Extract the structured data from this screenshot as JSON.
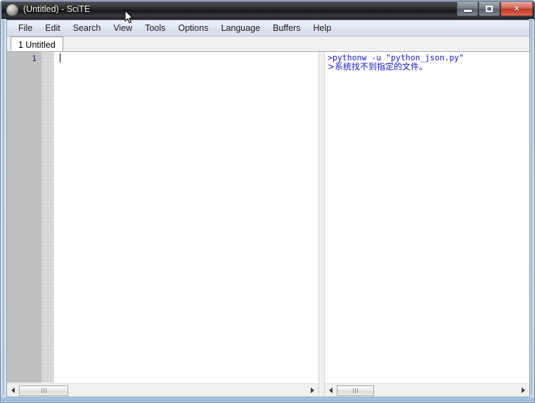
{
  "window": {
    "title": "(Untitled) - SciTE",
    "icon": "scite-ball-icon",
    "buttons": {
      "minimize": "minimize-button",
      "restore": "restore-button",
      "close_label": "✕"
    }
  },
  "menubar": {
    "items": [
      {
        "label": "File"
      },
      {
        "label": "Edit"
      },
      {
        "label": "Search"
      },
      {
        "label": "View"
      },
      {
        "label": "Tools"
      },
      {
        "label": "Options"
      },
      {
        "label": "Language"
      },
      {
        "label": "Buffers"
      },
      {
        "label": "Help"
      }
    ]
  },
  "tabbar": {
    "tabs": [
      {
        "label": "1 Untitled",
        "active": true
      }
    ]
  },
  "editor": {
    "line_numbers": [
      "1"
    ],
    "content": "",
    "caret_line": 1,
    "caret_column": 1
  },
  "output": {
    "lines": [
      ">pythonw -u \"python_json.py\"",
      ">系统找不到指定的文件。"
    ],
    "text_color": "#1515d0"
  },
  "scrollbars": {
    "editor_h": {
      "left_arrow": "◄",
      "right_arrow": "►"
    },
    "output_h": {
      "left_arrow": "◄",
      "right_arrow": "►"
    }
  },
  "colors": {
    "titlebar": "#1f1f22",
    "menubar": "#dfe4f2",
    "line_margin": "#c0c0c0",
    "editor_bg": "#ffffff",
    "output_text": "#1515d0",
    "close_button": "#b8341f",
    "frame": "#b4cde6"
  }
}
